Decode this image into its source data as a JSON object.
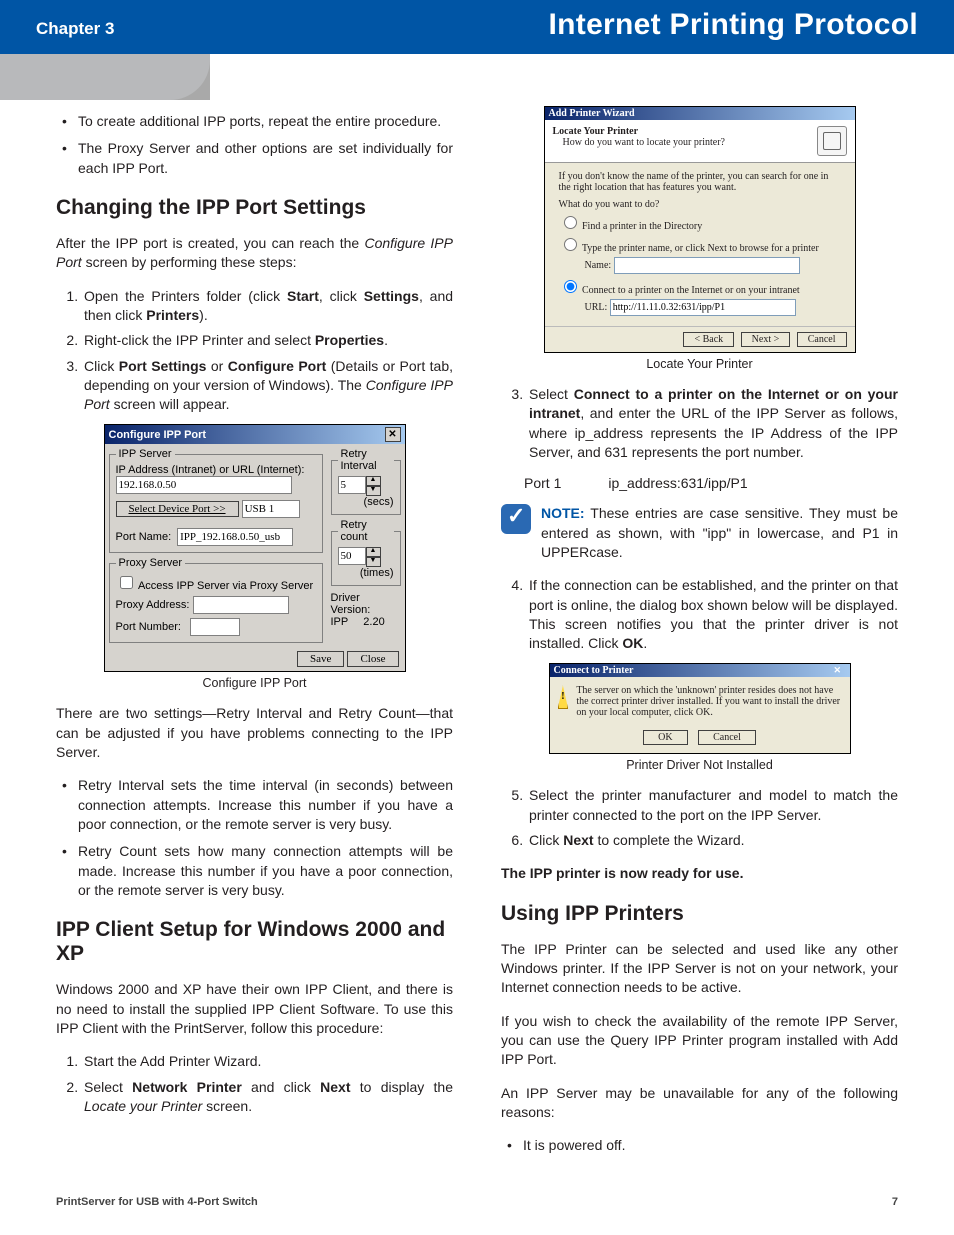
{
  "header": {
    "chapter": "Chapter 3",
    "title": "Internet Printing Protocol"
  },
  "left": {
    "intro_bullets": [
      "To create additional IPP ports, repeat the entire procedure.",
      "The Proxy Server and other options are set individually for each IPP Port."
    ],
    "h_changing": "Changing the IPP Port Settings",
    "changing_intro_a": "After the IPP port is created, you can reach the ",
    "changing_intro_i": "Configure IPP Port",
    "changing_intro_b": " screen by performing these steps:",
    "changing_steps": [
      {
        "pre": "Open the Printers folder (click ",
        "b1": "Start",
        "mid1": ", click ",
        "b2": "Settings",
        "mid2": ", and then click ",
        "b3": "Printers",
        "post": ")."
      },
      {
        "pre": "Right-click the IPP Printer and select ",
        "b1": "Properties",
        "post": "."
      },
      {
        "pre": "Click ",
        "b1": "Port Settings",
        "mid1": " or ",
        "b2": "Configure Port",
        "mid2": " (Details or Port tab, depending on your version of Windows). The ",
        "i": "Configure IPP Port",
        "post": " screen will appear."
      }
    ],
    "dlg_cfg": {
      "title": "Configure IPP Port",
      "grp_server": "IPP Server",
      "ip_label": "IP Address (Intranet) or URL (Internet):",
      "ip_value": "192.168.0.50",
      "select_btn": "Select Device Port >>",
      "select_val": "USB 1",
      "portname_lbl": "Port Name:",
      "portname_val": "IPP_192.168.0.50_usb",
      "grp_proxy": "Proxy Server",
      "proxy_chk": "Access IPP Server via Proxy Server",
      "proxy_addr": "Proxy Address:",
      "proxy_port": "Port Number:",
      "grp_retry": "Retry Interval",
      "retry_int_val": "5",
      "secs": "(secs)",
      "grp_count": "Retry count",
      "retry_cnt_val": "50",
      "times": "(times)",
      "drv": "Driver Version:",
      "drv_line": "IPP     2.20",
      "save": "Save",
      "close": "Close"
    },
    "fig1_caption": "Configure IPP Port",
    "after_dlg": "There are two settings—Retry Interval and Retry Count—that can be adjusted if you have problems connecting to the IPP Server.",
    "retry_bullets": [
      "Retry Interval sets the time interval (in seconds) between connection attempts. Increase this number if you have a poor connection, or the remote server is very busy.",
      "Retry Count sets how many connection attempts will be made. Increase this number if you have a poor connection, or the remote server is very busy."
    ],
    "h_client": "IPP Client Setup for Windows 2000 and XP",
    "client_intro": "Windows 2000 and XP have their own IPP Client, and there is no need to install the supplied IPP Client Software. To use this IPP Client with the PrintServer, follow this procedure:",
    "client_steps": {
      "s1": "Start the Add Printer Wizard.",
      "s2_pre": "Select ",
      "s2_b1": "Network Printer",
      "s2_mid": " and click ",
      "s2_b2": "Next",
      "s2_post_a": " to display the ",
      "s2_i": "Locate your Printer",
      "s2_post_b": " screen."
    }
  },
  "right": {
    "wiz": {
      "bar": "Add Printer Wizard",
      "h1": "Locate Your Printer",
      "h2": "How do you want to locate your printer?",
      "hint": "If you don't know the name of the printer, you can search for one in the right location that has features you want.",
      "q": "What do you want to do?",
      "r1": "Find a printer in the Directory",
      "r2": "Type the printer name, or click Next to browse for a printer",
      "name_lbl": "Name:",
      "r3": "Connect to a printer on the Internet or on your intranet",
      "url_lbl": "URL:",
      "url_val": "http://11.11.0.32:631/ipp/P1",
      "back": "< Back",
      "next": "Next >",
      "cancel": "Cancel"
    },
    "fig2_caption": "Locate Your Printer",
    "step3_pre": "Select ",
    "step3_b": "Connect to a printer on the Internet or on your intranet",
    "step3_post": ", and enter the URL of the IPP Server as follows, where ip_address represents the IP Address of the IPP Server, and 631 represents the port number.",
    "port_row": {
      "label": "Port 1",
      "value": "ip_address:631/ipp/P1"
    },
    "note_label": "NOTE:",
    "note_text": " These entries are case sensitive. They must be entered as shown, with \"ipp\" in lowercase, and P1 in UPPERcase.",
    "step4_a": "If the connection can be established, and the printer on that port is online, the  dialog box shown below will be displayed. This screen notifies you that the printer driver is not installed. Click ",
    "step4_b": "OK",
    "step4_c": ".",
    "msg": {
      "bar": "Connect to Printer",
      "text": "The server on which the 'unknown' printer resides does not have the correct printer driver installed. If you want to install the driver on your local computer, click OK.",
      "ok": "OK",
      "cancel": "Cancel"
    },
    "fig3_caption": "Printer Driver Not Installed",
    "step5": "Select the printer manufacturer and model to match the printer connected to the port on the IPP Server.",
    "step6_a": "Click ",
    "step6_b": "Next",
    "step6_c": " to complete the Wizard.",
    "ready": "The IPP printer is now ready for use.",
    "h_using": "Using IPP Printers",
    "using_p1": "The IPP Printer can be selected and used like any other Windows printer. If the IPP Server is not on your network, your Internet connection needs to be active.",
    "using_p2": "If you wish to check the availability of the remote IPP Server, you can use the Query IPP Printer program installed with Add IPP Port.",
    "using_p3": "An IPP Server may be unavailable for any of the following reasons:",
    "using_bul1": "It is powered off."
  },
  "footer": {
    "product": "PrintServer for USB with 4-Port Switch",
    "page": "7"
  }
}
